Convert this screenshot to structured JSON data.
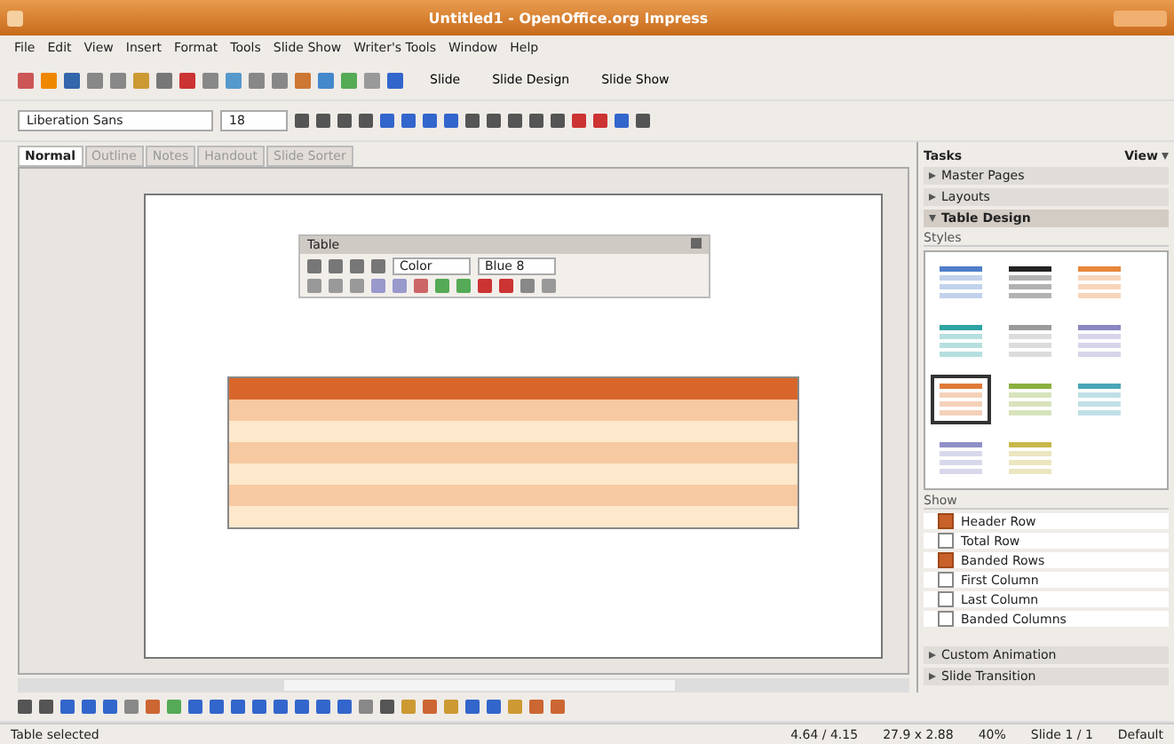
{
  "window": {
    "title": "Untitled1 - OpenOffice.org Impress"
  },
  "menu": [
    "File",
    "Edit",
    "View",
    "Insert",
    "Format",
    "Tools",
    "Slide Show",
    "Writer's Tools",
    "Window",
    "Help"
  ],
  "toolbar": {
    "buttons": [
      "Slide",
      "Slide Design",
      "Slide Show"
    ]
  },
  "format_bar": {
    "font": "Liberation Sans",
    "size": "18"
  },
  "view_tabs": [
    {
      "label": "Normal",
      "selected": true
    },
    {
      "label": "Outline",
      "selected": false
    },
    {
      "label": "Notes",
      "selected": false
    },
    {
      "label": "Handout",
      "selected": false
    },
    {
      "label": "Slide Sorter",
      "selected": false
    }
  ],
  "table_toolbar": {
    "title": "Table",
    "color_mode": "Color",
    "style_name": "Blue 8"
  },
  "tasks": {
    "title": "Tasks",
    "view": "View",
    "sections": [
      {
        "label": "Master Pages",
        "expanded": false
      },
      {
        "label": "Layouts",
        "expanded": false
      },
      {
        "label": "Table Design",
        "expanded": true
      }
    ],
    "styles_label": "Styles",
    "styles": [
      {
        "color": "#4f7fc8",
        "selected": false
      },
      {
        "color": "#222222",
        "selected": false
      },
      {
        "color": "#e8873a",
        "selected": false
      },
      {
        "color": "#2ea3a3",
        "selected": false
      },
      {
        "color": "#9a9a9a",
        "selected": false
      },
      {
        "color": "#8a86c0",
        "selected": false
      },
      {
        "color": "#e07a3a",
        "selected": true
      },
      {
        "color": "#8cb040",
        "selected": false
      },
      {
        "color": "#4aa7b8",
        "selected": false
      },
      {
        "color": "#8f8fc8",
        "selected": false
      },
      {
        "color": "#c8b84a",
        "selected": false
      }
    ],
    "show_label": "Show",
    "options": [
      {
        "label": "Header Row",
        "checked": true
      },
      {
        "label": "Total Row",
        "checked": false
      },
      {
        "label": "Banded Rows",
        "checked": true
      },
      {
        "label": "First Column",
        "checked": false
      },
      {
        "label": "Last Column",
        "checked": false
      },
      {
        "label": "Banded Columns",
        "checked": false
      }
    ],
    "footer_sections": [
      {
        "label": "Custom Animation",
        "expanded": false
      },
      {
        "label": "Slide Transition",
        "expanded": false
      }
    ]
  },
  "status_bar": [
    "Table selected",
    "4.64 / 4.15",
    "27.9 x 2.88",
    "40%",
    "Slide 1 / 1",
    "Default"
  ]
}
